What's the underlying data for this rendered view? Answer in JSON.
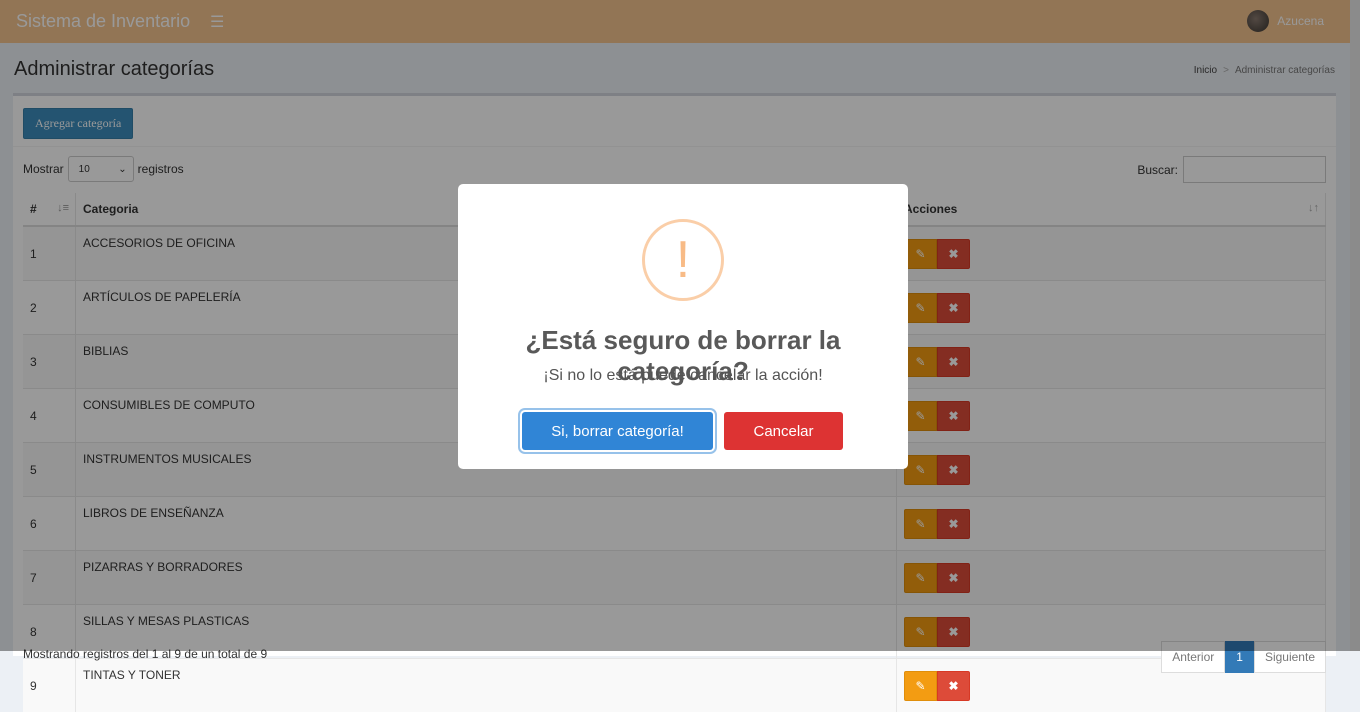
{
  "app": {
    "title": "Sistema de Inventario",
    "user_name": "Azucena"
  },
  "content_header": {
    "title": "Administrar categorías",
    "breadcrumb": [
      "Inicio",
      "Administrar categorías"
    ],
    "breadcrumb_sep": ">"
  },
  "toolbar": {
    "add_label": "Agregar categoría"
  },
  "table_controls": {
    "show_label": "Mostrar",
    "show_value": "10",
    "records_label": "registros",
    "search_label": "Buscar:"
  },
  "table": {
    "headers": [
      "#",
      "Categoria",
      "Acciones"
    ],
    "rows": [
      {
        "num": "1",
        "name": "ACCESORIOS DE OFICINA"
      },
      {
        "num": "2",
        "name": "ARTÍCULOS DE PAPELERÍA"
      },
      {
        "num": "3",
        "name": "BIBLIAS"
      },
      {
        "num": "4",
        "name": "CONSUMIBLES DE COMPUTO"
      },
      {
        "num": "5",
        "name": "INSTRUMENTOS MUSICALES"
      },
      {
        "num": "6",
        "name": "LIBROS DE ENSEÑANZA"
      },
      {
        "num": "7",
        "name": "PIZARRAS Y BORRADORES"
      },
      {
        "num": "8",
        "name": "SILLAS Y MESAS PLASTICAS"
      },
      {
        "num": "9",
        "name": "TINTAS Y TONER"
      }
    ]
  },
  "footer": {
    "info": "Mostrando registros del 1 al 9 de un total de 9",
    "pager": [
      "Anterior",
      "1",
      "Siguiente"
    ]
  },
  "dialog": {
    "icon": "!",
    "title": "¿Está seguro de borrar la categoría?",
    "text": "¡Si no lo está puede cancelar la acción!",
    "confirm_label": "Si, borrar categoría!",
    "cancel_label": "Cancelar"
  },
  "colors": {
    "header_bg": "#f3c38e",
    "primary": "#3085d6",
    "danger": "#dd3333",
    "warning": "#f8bb86"
  }
}
